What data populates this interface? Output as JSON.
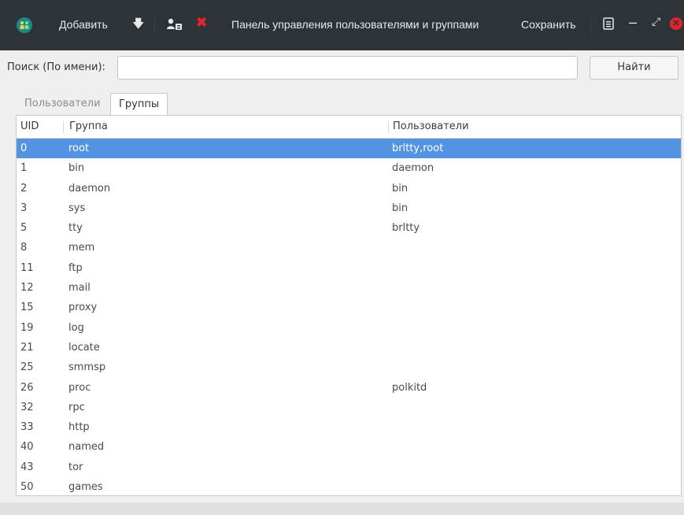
{
  "toolbar": {
    "add_label": "Добавить",
    "window_title": "Панель управления пользователями и группами",
    "save_label": "Сохранить"
  },
  "search": {
    "label": "Поиск (По имени):",
    "value": "",
    "button_label": "Найти"
  },
  "tabs": [
    {
      "label": "Пользователи",
      "active": false
    },
    {
      "label": "Группы",
      "active": true
    }
  ],
  "table": {
    "columns": [
      "UID",
      "Группа",
      "Пользователи"
    ],
    "rows": [
      {
        "uid": "0",
        "group": "root",
        "users": "brltty,root",
        "selected": true
      },
      {
        "uid": "1",
        "group": "bin",
        "users": "daemon"
      },
      {
        "uid": "2",
        "group": "daemon",
        "users": "bin"
      },
      {
        "uid": "3",
        "group": "sys",
        "users": "bin"
      },
      {
        "uid": "5",
        "group": "tty",
        "users": "brltty"
      },
      {
        "uid": "8",
        "group": "mem",
        "users": ""
      },
      {
        "uid": "11",
        "group": "ftp",
        "users": ""
      },
      {
        "uid": "12",
        "group": "mail",
        "users": ""
      },
      {
        "uid": "15",
        "group": "proxy",
        "users": ""
      },
      {
        "uid": "19",
        "group": "log",
        "users": ""
      },
      {
        "uid": "21",
        "group": "locate",
        "users": ""
      },
      {
        "uid": "25",
        "group": "smmsp",
        "users": ""
      },
      {
        "uid": "26",
        "group": "proc",
        "users": "polkitd"
      },
      {
        "uid": "32",
        "group": "rpc",
        "users": ""
      },
      {
        "uid": "33",
        "group": "http",
        "users": ""
      },
      {
        "uid": "40",
        "group": "named",
        "users": ""
      },
      {
        "uid": "43",
        "group": "tor",
        "users": ""
      },
      {
        "uid": "50",
        "group": "games",
        "users": ""
      }
    ]
  },
  "colors": {
    "titlebar_bg": "#2e3338",
    "selection": "#5294e2",
    "delete_red": "#e0232e",
    "app_icon": "#1a8a8a"
  }
}
